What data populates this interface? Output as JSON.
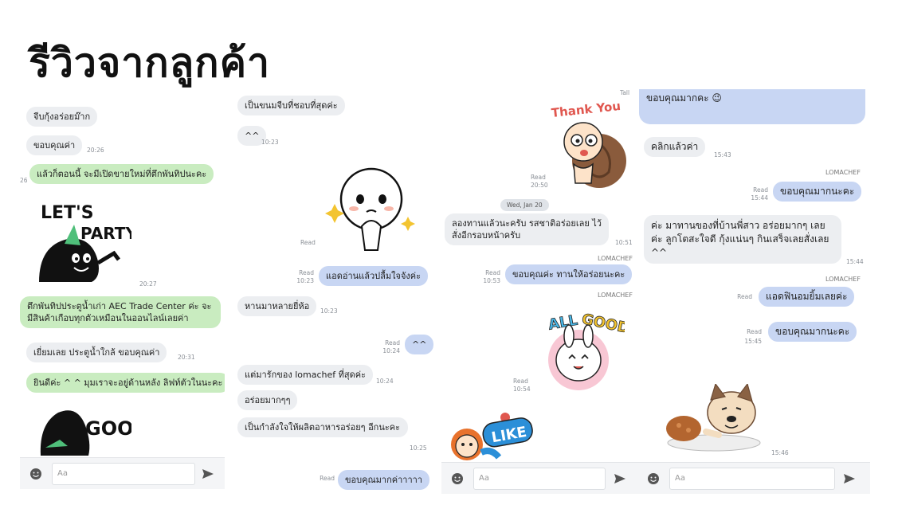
{
  "title": "รีวิวจากลูกค้า",
  "input_placeholder": "Aa",
  "panel1": {
    "messages": [
      {
        "text": "จีบกุ้งอร่อยม๊าก",
        "type": "recv"
      },
      {
        "text": "ขอบคุณค่า",
        "type": "recv",
        "time": "20:26"
      },
      {
        "text": "แล้วก็ตอนนี้ จะมีเปิดขายใหม่ที่ตึกพันทิปนะคะ",
        "type": "green",
        "side": "26"
      },
      {
        "sticker": "lets-party",
        "text": "LET'S PARTY",
        "time": "20:27"
      },
      {
        "text": "ตึกพันทิปประตูน้ำเก่า AEC Trade Center ค่ะ จะมีสินค้าเกือบทุกตัวเหมือนในออนไลน์เลยค่า",
        "type": "green"
      },
      {
        "text": "เยี่ยมเลย ประตูน้ำใกล้ ขอบคุณค่า",
        "type": "recv",
        "time": "20:31"
      },
      {
        "text": "ยินดีค่ะ ^ ^ มุมเราจะอยู่ด้านหลัง ลิฟท์ตัวในนะคะ",
        "type": "green"
      },
      {
        "sticker": "goo",
        "text": "GOO"
      }
    ]
  },
  "panel2": {
    "messages": [
      {
        "text": "เป็นขนมจีบที่ชอบที่สุดค่ะ",
        "type": "recv"
      },
      {
        "text": "^^",
        "type": "recv",
        "time": "10:23"
      },
      {
        "sticker": "moon-face"
      },
      {
        "read": "Read",
        "time": "10:23",
        "text": "แอดอ่านแล้วปลื้มใจจังค่ะ",
        "type": "sent",
        "read_top": "Read"
      },
      {
        "text": "หานมาหลายยี่ห้อ",
        "type": "recv",
        "time": "10:23"
      },
      {
        "read": "Read",
        "time": "10:24",
        "text": "^^",
        "type": "sent"
      },
      {
        "text": "แต่มารักของ lomachef ที่สุดค่ะ",
        "type": "recv",
        "time": "10:24"
      },
      {
        "text": "อร่อยมากๆๆ",
        "type": "recv"
      },
      {
        "text": "เป็นกำลังใจให้ผลิตอาหารอร่อยๆ อีกนะคะ",
        "type": "recv",
        "time": "10:25"
      },
      {
        "read": "Read",
        "text": "ขอบคุณมากค่าาาาา",
        "type": "sent"
      }
    ]
  },
  "panel3": {
    "top_time": "Tall",
    "messages": [
      {
        "sticker": "thank-you",
        "text": "Thank You",
        "read": "Read",
        "time": "20:50"
      },
      {
        "date": "Wed, Jan 20"
      },
      {
        "text": "ลองทานแล้วนะครับ รสชาติอร่อยเลย ไว้สั่งอีกรอบหน้าครับ",
        "type": "recv",
        "time": "10:51"
      },
      {
        "sender": "LOMACHEF",
        "read": "Read",
        "time": "10:53",
        "text": "ขอบคุณค่ะ ทานให้อร่อยนะคะ",
        "type": "sent"
      },
      {
        "sender": "LOMACHEF",
        "sticker": "all-good",
        "text": "ALL GOOD!",
        "read": "Read",
        "time": "10:54"
      },
      {
        "sticker": "like",
        "text": "LIKE"
      }
    ]
  },
  "panel4": {
    "messages": [
      {
        "text": "ขอบคุณมากคะ 😉",
        "type": "sent"
      },
      {
        "text": "คลิกแล้วค่า",
        "type": "recv",
        "time": "15:43"
      },
      {
        "sender": "LOMACHEF",
        "read": "Read",
        "time": "15:44",
        "text": "ขอบคุณมากนะคะ",
        "type": "sent"
      },
      {
        "text": "ค่ะ มาทานของที่บ้านพี่สาว อร่อยมากๆ เลยค่ะ ลูกโตสะใจดี กุ้งแน่นๆ กินเสร็จเลยสั่งเลย ^^",
        "type": "recv",
        "time": "15:44"
      },
      {
        "sender": "LOMACHEF",
        "read": "Read",
        "text": "แอดฟินอมยิ้มเลยค่ะ",
        "type": "sent"
      },
      {
        "read": "Read",
        "time": "15:45",
        "text": "ขอบคุณมากนะคะ",
        "type": "sent"
      },
      {
        "sticker": "french-bulldog",
        "time": "15:46"
      }
    ]
  },
  "colors": {
    "green_bubble": "#c9ecc0",
    "sent_bubble": "#c8d6f3",
    "recv_bubble": "#eceef1"
  },
  "icons": [
    "emoji-icon",
    "send-icon"
  ]
}
